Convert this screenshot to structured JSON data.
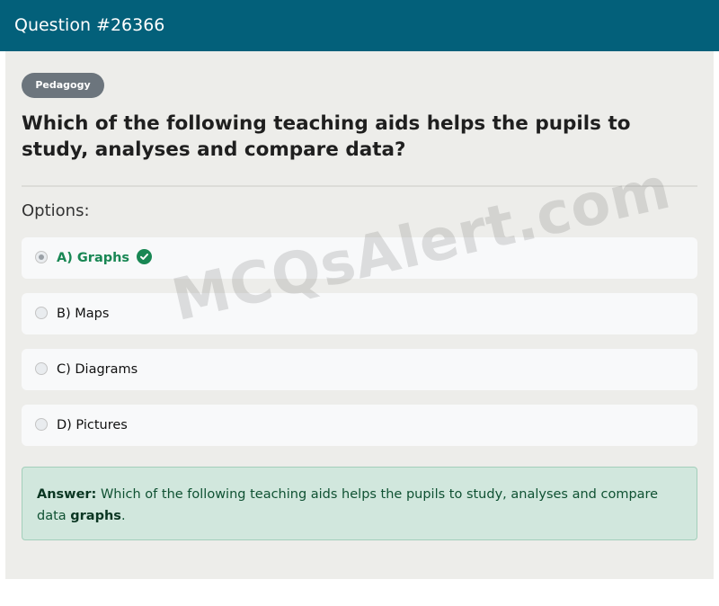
{
  "header": {
    "title": "Question #26366"
  },
  "category_badge": "Pedagogy",
  "question": "Which of the following teaching aids helps the pupils to study, analyses and compare data?",
  "options_label": "Options:",
  "options": [
    {
      "label": "A) Graphs",
      "selected": true,
      "correct": true
    },
    {
      "label": "B) Maps",
      "selected": false,
      "correct": false
    },
    {
      "label": "C) Diagrams",
      "selected": false,
      "correct": false
    },
    {
      "label": "D) Pictures",
      "selected": false,
      "correct": false
    }
  ],
  "answer": {
    "prefix": "Answer:",
    "text": "Which of the following teaching aids helps the pupils to study, analyses and compare data",
    "highlight": "graphs",
    "suffix": "."
  },
  "watermark": "MCQsAlert.com",
  "colors": {
    "header": "#03607a",
    "correct": "#198754",
    "answer_bg": "#d1e7dd"
  }
}
